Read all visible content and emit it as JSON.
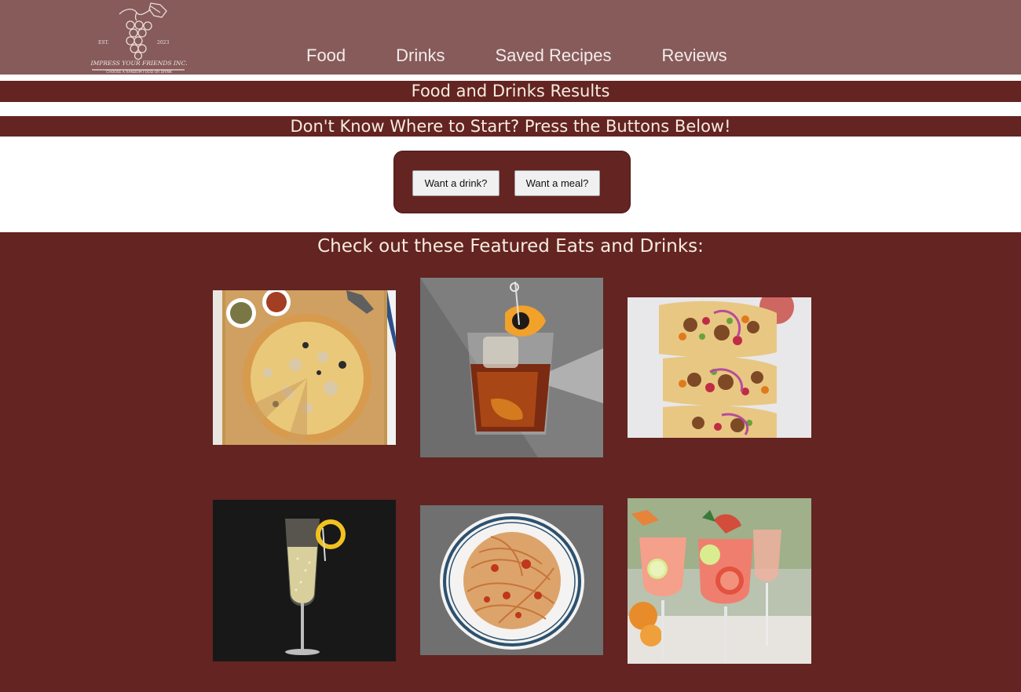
{
  "logo": {
    "est": "EST.",
    "year": "2023",
    "name": "IMPRESS YOUR FRIENDS INC.",
    "tagline": "CHOOSE A RANDOM FOOD OR DRINK"
  },
  "nav": {
    "items": [
      {
        "label": "Food"
      },
      {
        "label": "Drinks"
      },
      {
        "label": "Saved Recipes"
      },
      {
        "label": "Reviews"
      }
    ]
  },
  "results_heading": "Food and Drinks Results",
  "start_heading": "Don't Know Where to Start? Press the Buttons Below!",
  "buttons": {
    "drink": "Want a drink?",
    "meal": "Want a meal?"
  },
  "featured": {
    "title": "Check out these Featured Eats and Drinks:",
    "items": [
      {
        "image": "pizza-photo"
      },
      {
        "image": "old-fashioned-cocktail-photo"
      },
      {
        "image": "tacos-photo"
      },
      {
        "image": "champagne-photo"
      },
      {
        "image": "spaghetti-photo"
      },
      {
        "image": "spritz-cocktails-photo"
      }
    ]
  },
  "colors": {
    "header": "#865b5a",
    "brand_dark": "#632422",
    "band_text": "#f6ecdf"
  }
}
